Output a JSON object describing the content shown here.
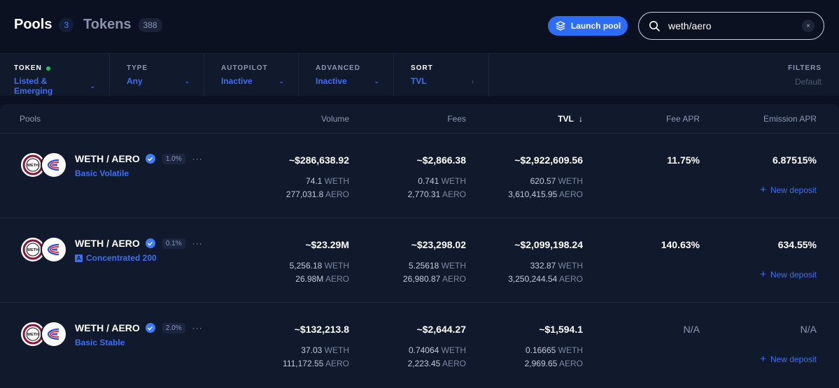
{
  "header": {
    "pools_tab": {
      "label": "Pools",
      "count": "3"
    },
    "tokens_tab": {
      "label": "Tokens",
      "count": "388"
    },
    "launch_label": "Launch pool",
    "search_value": "weth/aero",
    "clear_icon": "×"
  },
  "filters": {
    "token": {
      "title": "TOKEN",
      "value": "Listed & Emerging"
    },
    "type": {
      "title": "TYPE",
      "value": "Any"
    },
    "autopilot": {
      "title": "AUTOPILOT",
      "value": "Inactive"
    },
    "advanced": {
      "title": "ADVANCED",
      "value": "Inactive"
    },
    "sort": {
      "title": "SORT",
      "value": "TVL"
    },
    "filters": {
      "title": "FILTERS",
      "value": "Default"
    }
  },
  "table": {
    "columns": {
      "pools": "Pools",
      "volume": "Volume",
      "fees": "Fees",
      "tvl": "TVL",
      "fee_apr": "Fee APR",
      "emission_apr": "Emission APR"
    },
    "sort_arrow": "↓",
    "deposit_label": "New deposit",
    "rows": [
      {
        "name": "WETH / AERO",
        "fee": "1.0%",
        "type": "Basic Volatile",
        "volume": "~$286,638.92",
        "volume_weth": "74.1",
        "volume_aero": "277,031.8",
        "fees": "~$2,866.38",
        "fees_weth": "0.741",
        "fees_aero": "2,770.31",
        "tvl": "~$2,922,609.56",
        "tvl_weth": "620.57",
        "tvl_aero": "3,610,415.95",
        "fee_apr": "11.75%",
        "emission_apr": "6.87515%"
      },
      {
        "name": "WETH / AERO",
        "fee": "0.1%",
        "type": "Concentrated 200",
        "type_badge": "A",
        "volume": "~$23.29M",
        "volume_weth": "5,256.18",
        "volume_aero": "26.98M",
        "fees": "~$23,298.02",
        "fees_weth": "5.25618",
        "fees_aero": "26,980.87",
        "tvl": "~$2,099,198.24",
        "tvl_weth": "332.87",
        "tvl_aero": "3,250,244.54",
        "fee_apr": "140.63%",
        "emission_apr": "634.55%"
      },
      {
        "name": "WETH / AERO",
        "fee": "2.0%",
        "type": "Basic Stable",
        "volume": "~$132,213.8",
        "volume_weth": "37.03",
        "volume_aero": "111,172.55",
        "fees": "~$2,644.27",
        "fees_weth": "0.74064",
        "fees_aero": "2,223.45",
        "tvl": "~$1,594.1",
        "tvl_weth": "0.16665",
        "tvl_aero": "2,969.65",
        "fee_apr": "N/A",
        "emission_apr": "N/A"
      }
    ]
  },
  "units": {
    "weth": "WETH",
    "aero": "AERO"
  },
  "logo_text": {
    "weth": "WETH"
  },
  "icons": {
    "launch": "layers-icon",
    "search": "search-icon",
    "clear": "close-icon",
    "verified": "verified-check-icon",
    "more": "more-dots-icon",
    "chevron": "chevron-down-icon",
    "plus": "plus-icon"
  },
  "colors": {
    "background": "#0b1120",
    "panel": "#111a2c",
    "accent": "#2d6df6",
    "link": "#3e6ff1",
    "active_dot": "#22c55e"
  }
}
